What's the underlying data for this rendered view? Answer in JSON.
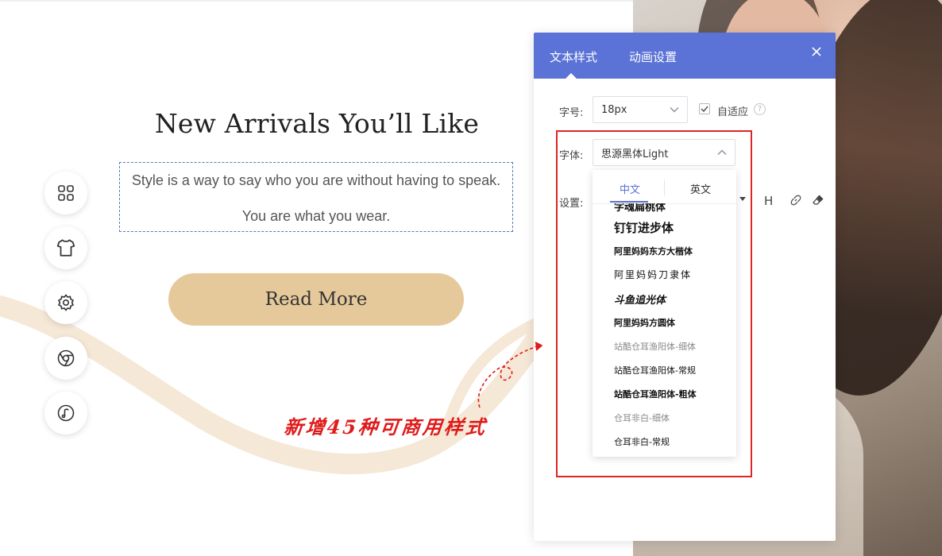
{
  "page": {
    "headline": "New Arrivals You’ll Like",
    "subtitle_line1": "Style is a way to say who you are without having to speak.",
    "subtitle_line2": "You are what you wear.",
    "button_label": "Read More"
  },
  "toolrail": {
    "icons": [
      "grid-icon",
      "tshirt-icon",
      "gear-icon",
      "chrome-icon",
      "music-icon"
    ]
  },
  "panel": {
    "tabs": [
      "文本样式",
      "动画设置"
    ],
    "active_tab": "文本样式",
    "font_size_label": "字号:",
    "font_size_value": "18px",
    "auto_fit_label": "自适应",
    "auto_fit_checked": true,
    "help_glyph": "?",
    "font_family_label": "字体:",
    "font_family_value": "思源黑体Light",
    "settings_label": "设置:",
    "heading_glyph": "H"
  },
  "font_dropdown": {
    "tabs": [
      "中文",
      "英文"
    ],
    "active_tab": "中文",
    "items": [
      "字魂扁桃体",
      "钉钉进步体",
      "阿里妈妈东方大楷体",
      "阿里妈妈刀隶体",
      "斗鱼追光体",
      "阿里妈妈方圆体",
      "站酷仓耳渔阳体-细体",
      "站酷仓耳渔阳体-常规",
      "站酷仓耳渔阳体-粗体",
      "仓耳非白-细体",
      "仓耳非白-常规"
    ]
  },
  "annotation": {
    "text": "新增45种可商用样式",
    "color": "#e01b1b"
  },
  "colors": {
    "panel_header": "#5b73d6",
    "button_bg": "#e6c99b",
    "highlight_frame": "#e02424"
  }
}
